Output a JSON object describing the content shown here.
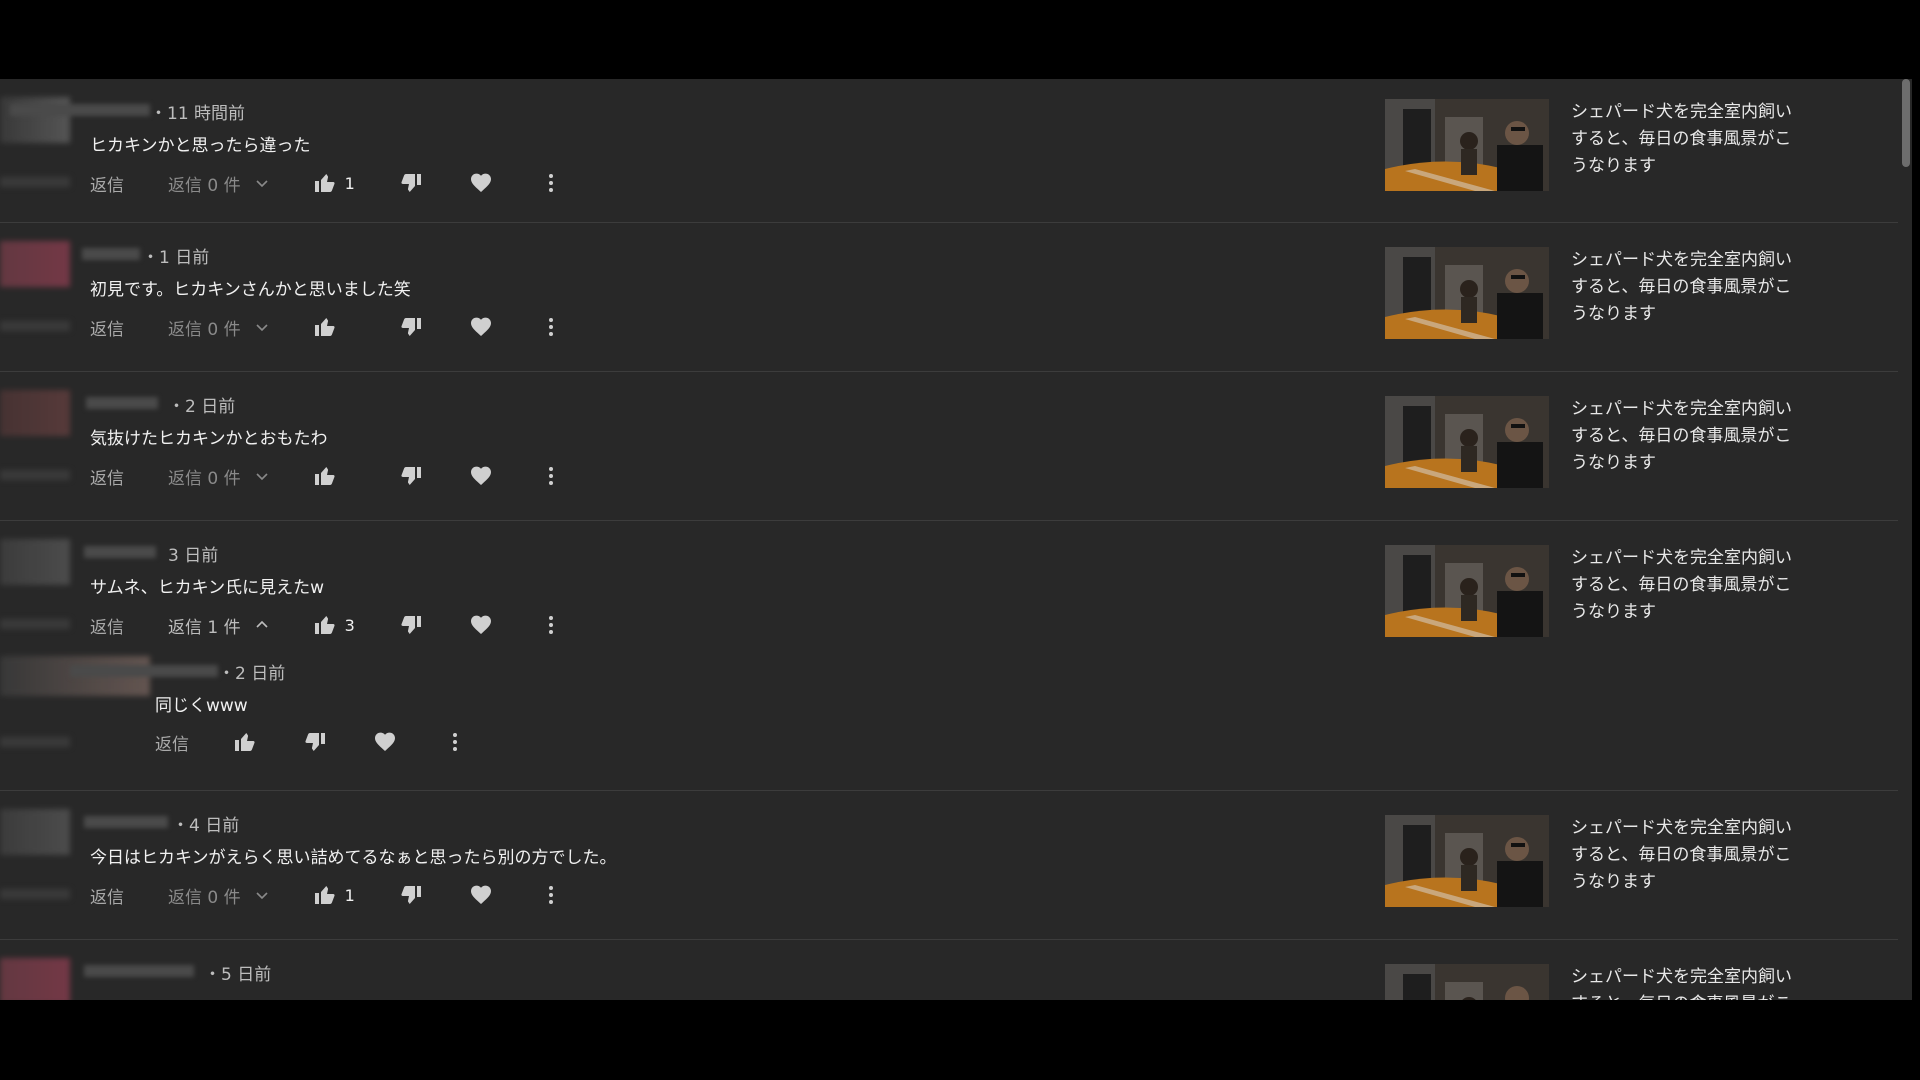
{
  "reply_label": "返信",
  "comments": [
    {
      "time": "・11 時間前",
      "text": "ヒカキンかと思ったら違った",
      "reply_count": "返信 0 件",
      "replies_expanded": false,
      "likes": "1",
      "video_title": "シェパード犬を完全室内飼いすると、毎日の食事風景がこうなります"
    },
    {
      "time": "・1 日前",
      "text": "初見です。ヒカキンさんかと思いました笑",
      "reply_count": "返信 0 件",
      "replies_expanded": false,
      "likes": "",
      "video_title": "シェパード犬を完全室内飼いすると、毎日の食事風景がこうなります"
    },
    {
      "time": "・2 日前",
      "text": "気抜けたヒカキンかとおもたわ",
      "reply_count": "返信 0 件",
      "replies_expanded": false,
      "likes": "",
      "video_title": "シェパード犬を完全室内飼いすると、毎日の食事風景がこうなります"
    },
    {
      "time": "3 日前",
      "text": "サムネ、ヒカキン氏に見えたw",
      "reply_count": "返信 1 件",
      "replies_expanded": true,
      "likes": "3",
      "video_title": "シェパード犬を完全室内飼いすると、毎日の食事風景がこうなります",
      "reply": {
        "time": "・2 日前",
        "text": "同じくwww"
      }
    },
    {
      "time": "・4 日前",
      "text": "今日はヒカキンがえらく思い詰めてるなぁと思ったら別の方でした。",
      "reply_count": "返信 0 件",
      "replies_expanded": false,
      "likes": "1",
      "video_title": "シェパード犬を完全室内飼いすると、毎日の食事風景がこうなります"
    },
    {
      "time": "・5 日前",
      "text": "",
      "video_title": "シェパード犬を完全室内飼いすると、毎日の食事風景がこうなります"
    }
  ]
}
